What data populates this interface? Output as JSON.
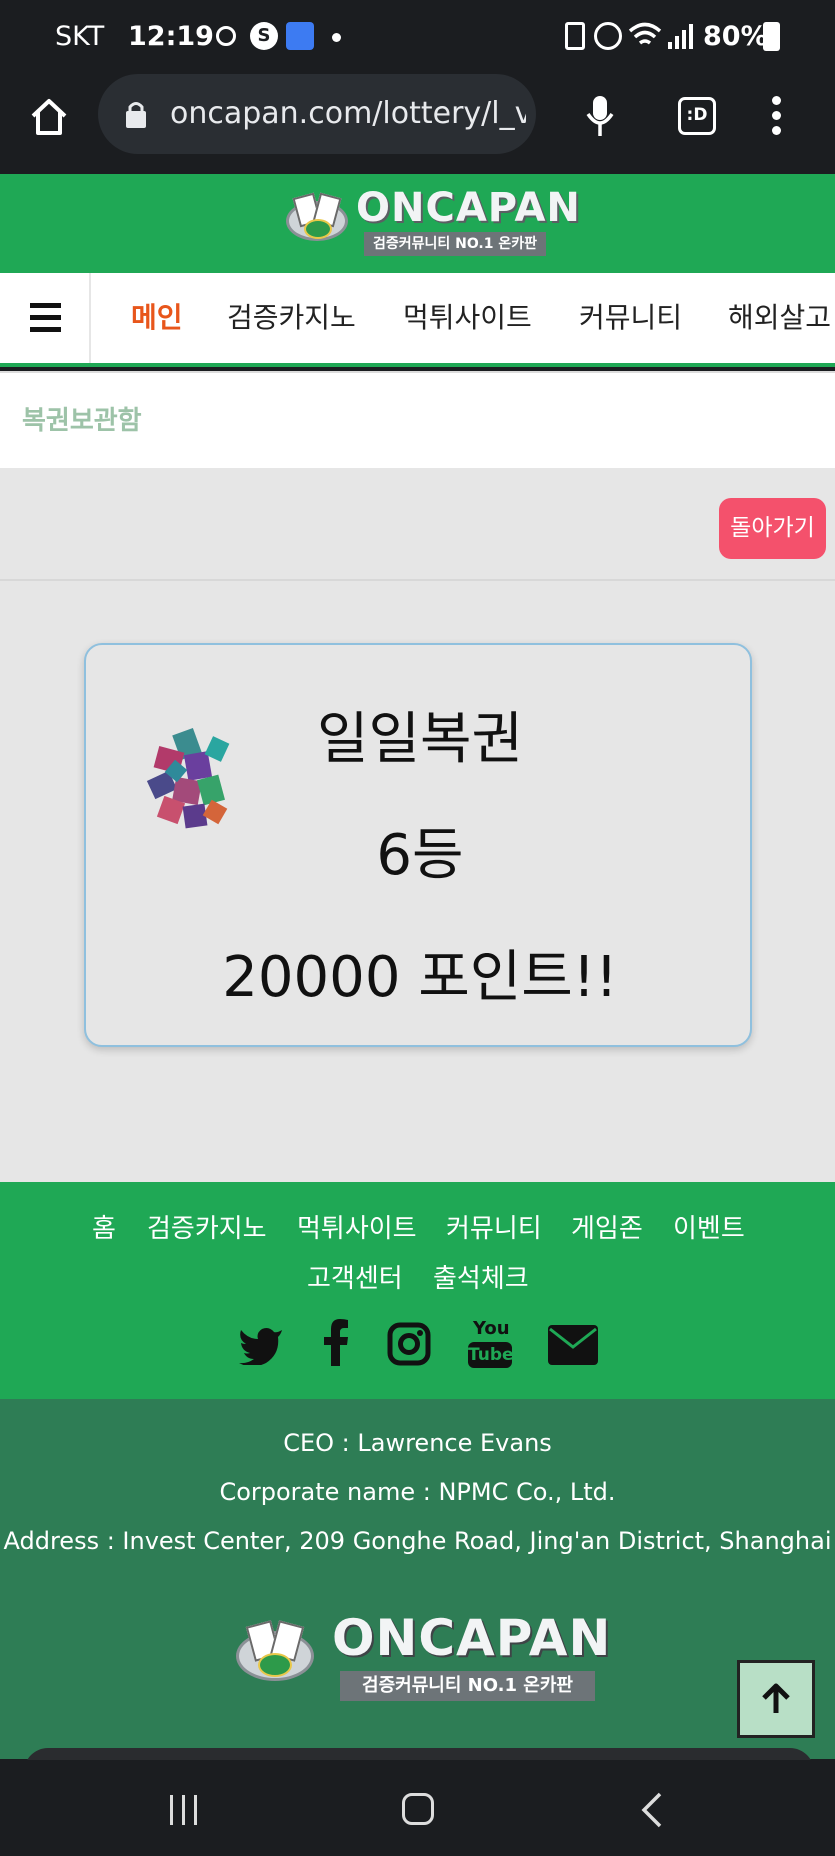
{
  "status_bar": {
    "carrier": "SKT",
    "time": "12:19",
    "battery": "80%",
    "icons": [
      "sync-icon",
      "s-icon",
      "tag-icon",
      "dot-icon",
      "recycle-icon",
      "alarm-icon",
      "wifi-icon",
      "signal-icon",
      "battery-icon"
    ]
  },
  "browser": {
    "url": "oncapan.com/lottery/l_v",
    "icons": [
      "home-icon",
      "lock-icon",
      "mic-icon",
      "tab-switcher-icon",
      "menu-dots-icon"
    ],
    "tab_label": ":D"
  },
  "brand": {
    "logo_text": "ONCAPAN",
    "logo_sub": "검증커뮤니티 NO.1 온카판"
  },
  "nav": {
    "items": [
      "메인",
      "검증카지노",
      "먹튀사이트",
      "커뮤니티",
      "해외살고"
    ]
  },
  "breadcrumb": "복권보관함",
  "back_button": "돌아가기",
  "lottery": {
    "name": "일일복권",
    "rank": "6등",
    "prize": "20000 포인트!!"
  },
  "footer": {
    "links": [
      "홈",
      "검증카지노",
      "먹튀사이트",
      "커뮤니티",
      "게임존",
      "이벤트",
      "고객센터",
      "출석체크"
    ],
    "social_icons": [
      "twitter-icon",
      "facebook-icon",
      "instagram-icon",
      "youtube-icon",
      "mail-icon"
    ],
    "youtube_top": "You",
    "youtube_bottom": "Tube",
    "ceo": "CEO : Lawrence Evans",
    "corporate": "Corporate name : NPMC Co., Ltd.",
    "address": "Address : Invest Center, 209 Gonghe Road, Jing'an District, Shanghai"
  },
  "colors": {
    "green": "#1fa855",
    "dark_green": "#2e7d55",
    "active_nav": "#e8561b",
    "back_btn": "#f4516c"
  }
}
